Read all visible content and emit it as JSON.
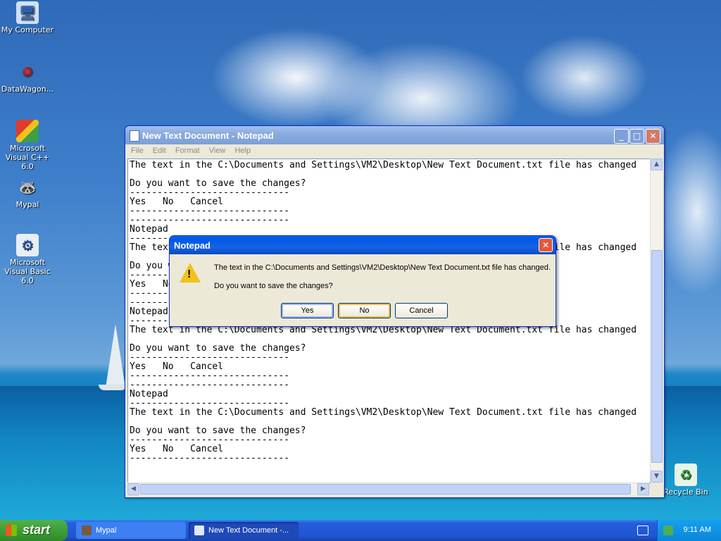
{
  "desktop": {
    "icons": [
      {
        "label": "My Computer",
        "icon": "computer-icon"
      },
      {
        "label": "DataWagon...",
        "icon": "datawagon-icon"
      },
      {
        "label": "Microsoft Visual C++ 6.0",
        "icon": "visual-cpp-icon"
      },
      {
        "label": "Mypal",
        "icon": "mypal-icon"
      },
      {
        "label": "Microsoft Visual Basic 6.0",
        "icon": "visual-basic-icon"
      },
      {
        "label": "Recycle Bin",
        "icon": "recycle-bin-icon"
      }
    ]
  },
  "notepad": {
    "title": "New Text Document - Notepad",
    "menu": [
      "File",
      "Edit",
      "Format",
      "View",
      "Help"
    ],
    "controls": {
      "minimize": "_",
      "maximize": "□",
      "close": "✕"
    },
    "content": "The text in the C:\\Documents and Settings\\VM2\\Desktop\\New Text Document.txt file has changed\n\nDo you want to save the changes?\n-----------------------------\nYes   No   Cancel\n-----------------------------\n-----------------------------\nNotepad\n-----------------------------\nThe text in the C:\\Documents and Settings\\VM2\\Desktop\\New Text Document.txt file has changed\n\nDo you want to save the changes?\n-----------------------------\nYes   No   Cancel\n-----------------------------\n-----------------------------\nNotepad\n-----------------------------\nThe text in the C:\\Documents and Settings\\VM2\\Desktop\\New Text Document.txt file has changed\n\nDo you want to save the changes?\n-----------------------------\nYes   No   Cancel\n-----------------------------\n-----------------------------\nNotepad\n-----------------------------\nThe text in the C:\\Documents and Settings\\VM2\\Desktop\\New Text Document.txt file has changed\n\nDo you want to save the changes?\n-----------------------------\nYes   No   Cancel\n-----------------------------"
  },
  "dialog": {
    "title": "Notepad",
    "close": "✕",
    "warning_mark": "!",
    "message_line1": "The text in the C:\\Documents and Settings\\VM2\\Desktop\\New Text Document.txt file has changed.",
    "message_line2": "Do you want to save the changes?",
    "buttons": {
      "yes": "Yes",
      "no": "No",
      "cancel": "Cancel"
    }
  },
  "taskbar": {
    "start_label": "start",
    "items": [
      {
        "label": "Mypal",
        "icon": "mypal-icon"
      },
      {
        "label": "New Text Document -...",
        "icon": "notepad-icon"
      }
    ],
    "clock": "9:11 AM"
  }
}
